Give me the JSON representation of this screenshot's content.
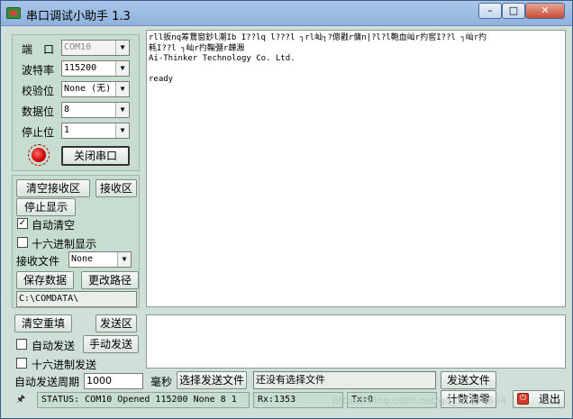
{
  "window": {
    "title": "串口调试小助手 1.3",
    "minimize": "–",
    "maximize": "□",
    "close": "✕"
  },
  "settings": {
    "port_label": "端　口",
    "port_value": "COM10",
    "baud_label": "波特率",
    "baud_value": "115200",
    "parity_label": "校验位",
    "parity_value": "None (无)",
    "databits_label": "数据位",
    "databits_value": "8",
    "stopbits_label": "停止位",
    "stopbits_value": "1",
    "close_port_button": "关闭串口"
  },
  "receive": {
    "clear_button": "清空接收区",
    "area_button": "接收区",
    "stop_button": "停止显示",
    "auto_clear_label": "自动清空",
    "auto_clear_checked": "✓",
    "hex_display_label": "十六进制显示",
    "file_label": "接收文件",
    "file_value": "None",
    "save_button": "保存数据",
    "change_path_button": "更改路径",
    "path_value": "C:\\COMDATA\\",
    "text": "rll扳nq筹鵞窗鈔l潮Ib I??lq l???l ┐rl屾┐?傯戳r傭n|?l?l鞄血屾r扚窖I??l ┐屾r扚\n耗I??l ┐屾r扚鞠弸r韡溵\nAi-Thinker Technology Co. Ltd.\n\nready"
  },
  "send": {
    "clear_button": "清空重填",
    "area_button": "发送区",
    "auto_send_label": "自动发送",
    "manual_send_button": "手动发送",
    "hex_send_label": "十六进制发送",
    "period_label": "自动发送周期",
    "period_value": "1000",
    "ms_label": "毫秒",
    "select_file_button": "选择发送文件",
    "file_status": "还没有选择文件",
    "send_file_button": "发送文件"
  },
  "statusbar": {
    "pin_icon": "pin-icon",
    "status_text": "STATUS: COM10 Opened 115200 None  8 1",
    "rx_text": "Rx:1353",
    "tx_text": "Tx:0",
    "count_clear_button": "计数清零",
    "exit_button": "退出",
    "watermark": "https://blog.csdn.net/qq_35350654"
  }
}
